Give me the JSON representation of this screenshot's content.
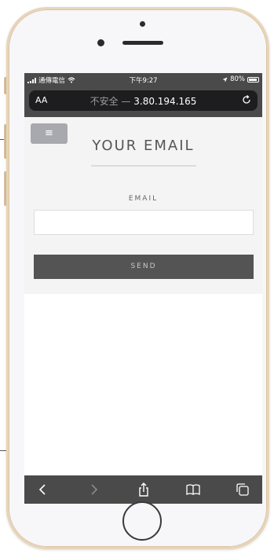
{
  "status_bar": {
    "carrier": "通傳電信",
    "time": "下午9:27",
    "battery": "80%"
  },
  "address_bar": {
    "aa_label": "AA",
    "security_text": "不安全",
    "separator": " — ",
    "url": "3.80.194.165"
  },
  "page": {
    "menu_icon": "≡",
    "title": "YOUR EMAIL",
    "email_label": "EMAIL",
    "email_value": "",
    "email_placeholder": "",
    "send_label": "SEND"
  },
  "toolbar": {
    "icons": [
      "back-icon",
      "forward-icon",
      "share-icon",
      "bookmarks-icon",
      "tabs-icon"
    ]
  },
  "colors": {
    "browser_chrome": "#4a4a4a",
    "address_field": "#1d1d1f",
    "page_background": "#f4f4f4",
    "menu_button": "#a7a9ae",
    "send_button": "#545454",
    "phone_trim": "#e8d5b8"
  }
}
